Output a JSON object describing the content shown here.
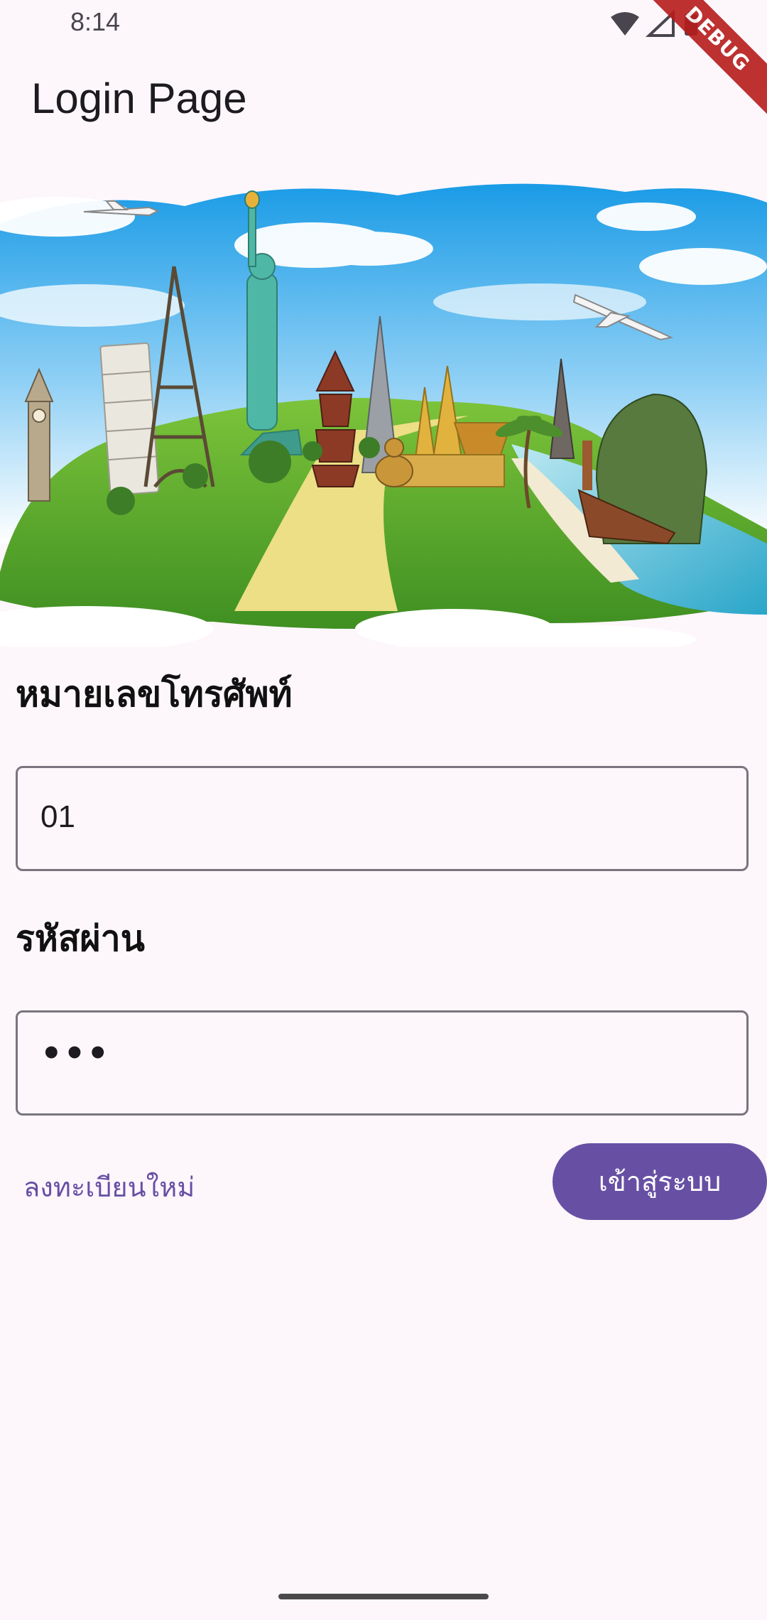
{
  "status_bar": {
    "time": "8:14"
  },
  "debug_banner": {
    "label": "DEBUG"
  },
  "app_bar": {
    "title": "Login Page"
  },
  "form": {
    "phone": {
      "label": "หมายเลขโทรศัพท์",
      "value": "01"
    },
    "password": {
      "label": "รหัสผ่าน",
      "masked_value": "•••"
    },
    "register_label": "ลงทะเบียนใหม่",
    "login_label": "เข้าสู่ระบบ"
  },
  "colors": {
    "background": "#fdf7fc",
    "primary": "#6750a4",
    "outline": "#79747e"
  }
}
